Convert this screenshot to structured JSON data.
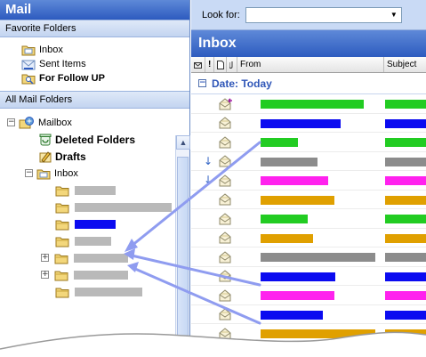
{
  "nav": {
    "title": "Mail",
    "favorites_header": "Favorite Folders",
    "favorites": [
      {
        "label": "Inbox",
        "icon": "inbox-folder-icon",
        "bold": false
      },
      {
        "label": "Sent Items",
        "icon": "sent-items-icon",
        "bold": false
      },
      {
        "label": "For Follow UP",
        "icon": "search-folder-icon",
        "bold": true
      }
    ],
    "all_folders_header": "All Mail Folders",
    "tree": {
      "mailbox": "Mailbox",
      "deleted": "Deleted Folders",
      "drafts": "Drafts",
      "inbox": "Inbox"
    },
    "subfolders": [
      {
        "color": "#b9b9b9",
        "bar_fraction": 0.39,
        "highlighted": false,
        "expandable": false
      },
      {
        "color": "#b9b9b9",
        "bar_fraction": 0.92,
        "highlighted": false,
        "expandable": false
      },
      {
        "color": "#0b0bf0",
        "bar_fraction": 0.39,
        "highlighted": true,
        "expandable": false
      },
      {
        "color": "#b9b9b9",
        "bar_fraction": 0.35,
        "highlighted": false,
        "expandable": false
      },
      {
        "color": "#b9b9b9",
        "bar_fraction": 0.52,
        "highlighted": false,
        "expandable": true
      },
      {
        "color": "#b9b9b9",
        "bar_fraction": 0.52,
        "highlighted": false,
        "expandable": true
      },
      {
        "color": "#b9b9b9",
        "bar_fraction": 0.64,
        "highlighted": false,
        "expandable": false
      }
    ]
  },
  "main": {
    "look_for_label": "Look for:",
    "look_for_value": "",
    "inbox_title": "Inbox",
    "columns": {
      "from": "From",
      "subject": "Subject"
    },
    "group_label": "Date: Today",
    "messages": [
      {
        "from_color": "#22cc22",
        "from_fraction": 0.83,
        "subj_color": "#22cc22",
        "icon": "reply-envelope-icon",
        "flag": ""
      },
      {
        "from_color": "#0b0bf0",
        "from_fraction": 0.64,
        "subj_color": "#0b0bf0",
        "icon": "open-envelope-icon",
        "flag": ""
      },
      {
        "from_color": "#22cc22",
        "from_fraction": 0.3,
        "subj_color": "#22cc22",
        "icon": "open-envelope-icon",
        "flag": ""
      },
      {
        "from_color": "#8c8c8c",
        "from_fraction": 0.46,
        "subj_color": "#8c8c8c",
        "icon": "open-envelope-icon",
        "flag": "↓"
      },
      {
        "from_color": "#ff22ee",
        "from_fraction": 0.54,
        "subj_color": "#ff22ee",
        "icon": "open-envelope-icon",
        "flag": "↓"
      },
      {
        "from_color": "#e0a000",
        "from_fraction": 0.59,
        "subj_color": "#e0a000",
        "icon": "open-envelope-icon",
        "flag": ""
      },
      {
        "from_color": "#22cc22",
        "from_fraction": 0.38,
        "subj_color": "#22cc22",
        "icon": "open-envelope-icon",
        "flag": ""
      },
      {
        "from_color": "#e0a000",
        "from_fraction": 0.42,
        "subj_color": "#e0a000",
        "icon": "open-envelope-icon",
        "flag": ""
      },
      {
        "from_color": "#8c8c8c",
        "from_fraction": 0.92,
        "subj_color": "#8c8c8c",
        "icon": "open-envelope-icon",
        "flag": ""
      },
      {
        "from_color": "#0b0bf0",
        "from_fraction": 0.6,
        "subj_color": "#0b0bf0",
        "icon": "open-envelope-icon",
        "flag": ""
      },
      {
        "from_color": "#ff22ee",
        "from_fraction": 0.59,
        "subj_color": "#ff22ee",
        "icon": "open-envelope-icon",
        "flag": ""
      },
      {
        "from_color": "#0b0bf0",
        "from_fraction": 0.5,
        "subj_color": "#0b0bf0",
        "icon": "open-envelope-icon",
        "flag": ""
      },
      {
        "from_color": "#e0a000",
        "from_fraction": 0.92,
        "subj_color": "#e0a000",
        "icon": "open-envelope-icon",
        "flag": ""
      }
    ]
  },
  "colors": {
    "accent": "#2d5bbf",
    "arrow": "#8f9cf0",
    "header_light": "#c9daf5"
  }
}
